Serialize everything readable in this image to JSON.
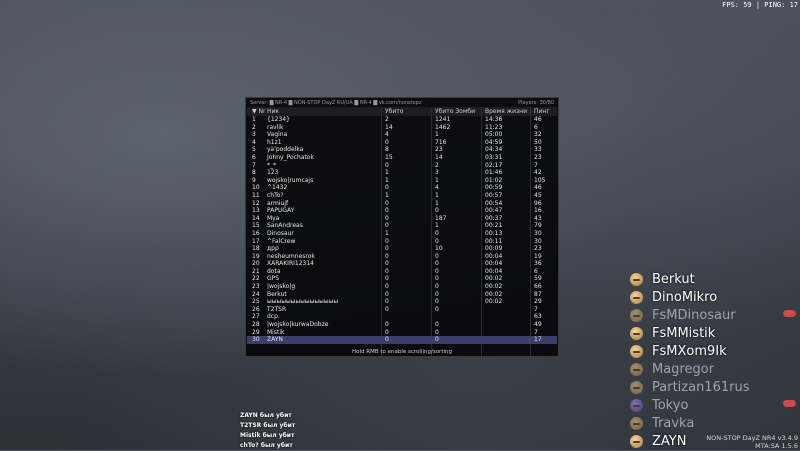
{
  "hud": {
    "fps_ping": "FPS: 59 | PING: 17"
  },
  "scoreboard": {
    "server_line": "Server: ▇ NR-4 ▇ NON-STOP DayZ RU/UA ▇ NR-4 ▇ vk.com/nonstopz",
    "players_count": "Players: 30/80",
    "columns": {
      "num": "▼ Nr",
      "name": "Ник",
      "kills": "Убито",
      "zombies": "Убито Зомби",
      "time": "Время жизни",
      "ping": "Пинг"
    },
    "rows": [
      {
        "n": "1",
        "name": "{1234}",
        "k": "2",
        "z": "1241",
        "t": "14:36",
        "p": "46"
      },
      {
        "n": "2",
        "name": "ravlik",
        "k": "14",
        "z": "1462",
        "t": "11:23",
        "p": "6"
      },
      {
        "n": "3",
        "name": "Vagina",
        "k": "4",
        "z": "1",
        "t": "05:00",
        "p": "32"
      },
      {
        "n": "4",
        "name": "h1z1",
        "k": "0",
        "z": "716",
        "t": "04:59",
        "p": "50"
      },
      {
        "n": "5",
        "name": "ya'poddelka",
        "k": "8",
        "z": "23",
        "t": "04:34",
        "p": "33"
      },
      {
        "n": "6",
        "name": "Johny_Pochatok",
        "k": "15",
        "z": "14",
        "t": "03:31",
        "p": "23"
      },
      {
        "n": "7",
        "name": "*_*",
        "k": "0",
        "z": "2",
        "t": "02:17",
        "p": "7"
      },
      {
        "n": "8",
        "name": "123",
        "k": "1",
        "z": "3",
        "t": "01:46",
        "p": "42"
      },
      {
        "n": "9",
        "name": "wojsko|rumcajs",
        "k": "1",
        "z": "1",
        "t": "01:02",
        "p": "105"
      },
      {
        "n": "10",
        "name": "^1432",
        "k": "0",
        "z": "4",
        "t": "00:59",
        "p": "46"
      },
      {
        "n": "11",
        "name": "chTo?",
        "k": "1",
        "z": "1",
        "t": "00:57",
        "p": "45"
      },
      {
        "n": "12",
        "name": "armiujf",
        "k": "0",
        "z": "1",
        "t": "00:54",
        "p": "96"
      },
      {
        "n": "13",
        "name": "PAPUGAY",
        "k": "0",
        "z": "0",
        "t": "00:47",
        "p": "16"
      },
      {
        "n": "14",
        "name": "Mya",
        "k": "0",
        "z": "187",
        "t": "00:37",
        "p": "43"
      },
      {
        "n": "15",
        "name": "SanAndreas",
        "k": "0",
        "z": "1",
        "t": "00:21",
        "p": "79"
      },
      {
        "n": "16",
        "name": "Dinosaur",
        "k": "1",
        "z": "0",
        "t": "00:13",
        "p": "30"
      },
      {
        "n": "17",
        "name": "^FalCrew",
        "k": "0",
        "z": "0",
        "t": "00:11",
        "p": "30"
      },
      {
        "n": "18",
        "name": "дрр",
        "k": "0",
        "z": "10",
        "t": "00:09",
        "p": "23"
      },
      {
        "n": "19",
        "name": "nesheumnesrok",
        "k": "0",
        "z": "0",
        "t": "00:04",
        "p": "19"
      },
      {
        "n": "20",
        "name": "XARAKIRI12314",
        "k": "0",
        "z": "0",
        "t": "00:04",
        "p": "36"
      },
      {
        "n": "21",
        "name": "dota",
        "k": "0",
        "z": "0",
        "t": "00:04",
        "p": "6"
      },
      {
        "n": "22",
        "name": "GPS",
        "k": "0",
        "z": "0",
        "t": "00:02",
        "p": "59"
      },
      {
        "n": "23",
        "name": "|wojsko|g",
        "k": "0",
        "z": "0",
        "t": "00:02",
        "p": "66"
      },
      {
        "n": "24",
        "name": "Berkut",
        "k": "0",
        "z": "0",
        "t": "00:02",
        "p": "87"
      },
      {
        "n": "25",
        "name": "ыыыыыыыыыыыыыыы",
        "k": "0",
        "z": "0",
        "t": "00:02",
        "p": "29"
      },
      {
        "n": "26",
        "name": "T2TSR",
        "k": "0",
        "z": "0",
        "t": "",
        "p": "7"
      },
      {
        "n": "27",
        "name": "dcp.",
        "k": "",
        "z": "",
        "t": "",
        "p": "63"
      },
      {
        "n": "28",
        "name": "|wojsko|kurwaDobze",
        "k": "0",
        "z": "0",
        "t": "",
        "p": "49"
      },
      {
        "n": "29",
        "name": "Mistik",
        "k": "0",
        "z": "0",
        "t": "",
        "p": "7"
      },
      {
        "n": "30",
        "name": "ZAYN",
        "k": "0",
        "z": "0",
        "t": "",
        "p": "17"
      }
    ],
    "footer": "Hold RMB to enable scrolling/sorting"
  },
  "kill_feed": [
    "ZAYN был убит",
    "T2TSR был убит",
    "Mistik был убит",
    "chTo? был убит"
  ],
  "player_list": [
    {
      "name": "Berkut",
      "dim": false
    },
    {
      "name": "DinoMikro",
      "dim": false
    },
    {
      "name": "FsMDinosaur",
      "dim": true
    },
    {
      "name": "FsMMistik",
      "dim": false
    },
    {
      "name": "FsMXom9Ik",
      "dim": false
    },
    {
      "name": "Magregor",
      "dim": true
    },
    {
      "name": "Partizan161rus",
      "dim": true
    },
    {
      "name": "Tokyo",
      "dim": true
    },
    {
      "name": "Travka",
      "dim": true
    },
    {
      "name": "ZAYN",
      "dim": false
    }
  ],
  "version": {
    "line1": "NON-STOP DayZ NR4 v3.4.9",
    "line2": "MTA:SA 1.5.6"
  }
}
